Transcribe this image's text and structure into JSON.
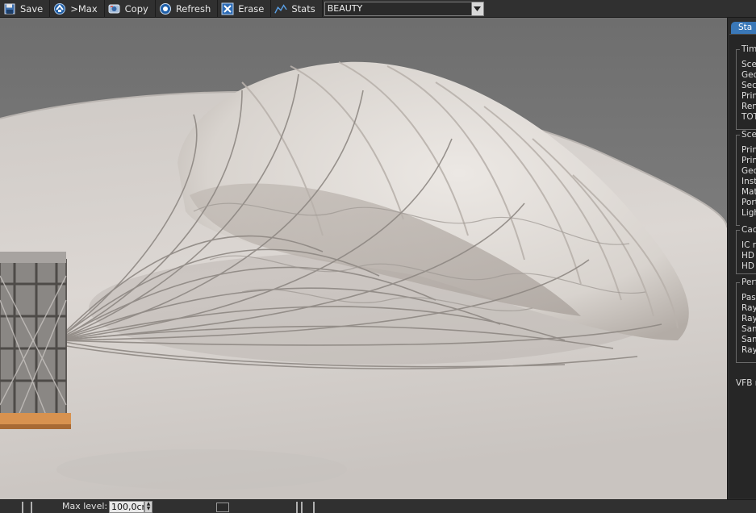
{
  "toolbar": {
    "buttons": [
      {
        "label": "Save",
        "icon": "save-icon"
      },
      {
        "label": ">Max",
        "icon": "max-icon"
      },
      {
        "label": "Copy",
        "icon": "copy-icon"
      },
      {
        "label": "Refresh",
        "icon": "refresh-icon"
      },
      {
        "label": "Erase",
        "icon": "erase-icon"
      },
      {
        "label": "Stats",
        "icon": "stats-icon"
      }
    ],
    "channel_select": "BEAUTY"
  },
  "stats_panel": {
    "tab_label": "Sta",
    "groups": [
      {
        "title": "Time",
        "items": [
          "Scen",
          "Geo",
          "Seco",
          "Prim",
          "Ren",
          "TOT"
        ]
      },
      {
        "title": "Scen",
        "items": [
          "Prim",
          "Prim",
          "Geo",
          "Insta",
          "Mat",
          "Port",
          "Ligh"
        ]
      },
      {
        "title": "Cac",
        "items": [
          "IC re",
          "HD r",
          "HD s"
        ]
      },
      {
        "title": "Perf",
        "items": [
          "Pass",
          "Ray",
          "Ray",
          "Sam",
          "Sam",
          "Ray"
        ]
      }
    ],
    "footer": "VFB re"
  },
  "bottombar": {
    "max_level_label": "Max level:",
    "max_level_value": "100,0cm"
  },
  "colors": {
    "toolbar_bg": "#303030",
    "accent_blue": "#3a78b8",
    "render_bg": "#7d7d7d",
    "cloth": "#d9d4cf"
  }
}
